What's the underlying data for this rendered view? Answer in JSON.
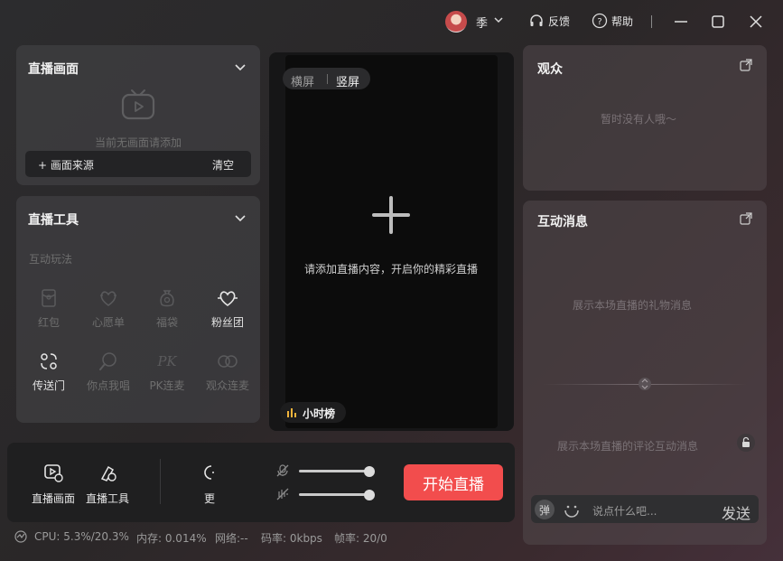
{
  "titlebar": {
    "username": "季",
    "feedback": "反馈",
    "help": "帮助"
  },
  "live_view": {
    "title": "直播画面",
    "empty_text": "当前无画面请添加",
    "add_source": "+ 画面来源",
    "clear": "清空"
  },
  "live_tools": {
    "title": "直播工具",
    "section": "互动玩法",
    "items": [
      {
        "label": "红包",
        "icon": "red-packet-icon",
        "enabled": false
      },
      {
        "label": "心愿单",
        "icon": "wishlist-icon",
        "enabled": false
      },
      {
        "label": "福袋",
        "icon": "lucky-bag-icon",
        "enabled": false
      },
      {
        "label": "粉丝团",
        "icon": "fan-club-icon",
        "enabled": true
      },
      {
        "label": "传送门",
        "icon": "portal-icon",
        "enabled": true
      },
      {
        "label": "你点我唱",
        "icon": "song-request-icon",
        "enabled": false
      },
      {
        "label": "PK连麦",
        "icon": "pk-icon",
        "enabled": false
      },
      {
        "label": "观众连麦",
        "icon": "audience-link-icon",
        "enabled": false
      }
    ]
  },
  "preview": {
    "landscape": "横屏",
    "portrait": "竖屏",
    "hint": "请添加直播内容，开启你的精彩直播",
    "hourly_rank": "小时榜"
  },
  "bottom": {
    "live_view_btn": "直播画面",
    "live_tools_btn": "直播工具",
    "more_btn": "更",
    "start_live": "开始直播",
    "mic_volume": 0.95,
    "speaker_volume": 0.95
  },
  "status": {
    "cpu": "CPU: 5.3%/20.3%",
    "memory": "内存: 0.014%",
    "network": "网络:--",
    "bitrate": "码率: 0kbps",
    "framerate": "帧率: 20/0"
  },
  "audience": {
    "title": "观众",
    "empty": "暂时没有人哦～"
  },
  "interaction": {
    "title": "互动消息",
    "gifts_hint": "展示本场直播的礼物消息",
    "comments_hint": "展示本场直播的评论互动消息",
    "danmu": "弹",
    "input_placeholder": "说点什么吧...",
    "send": "发送"
  },
  "colors": {
    "accent": "#f24d4d",
    "hourly_icon": "#f0b43c"
  }
}
